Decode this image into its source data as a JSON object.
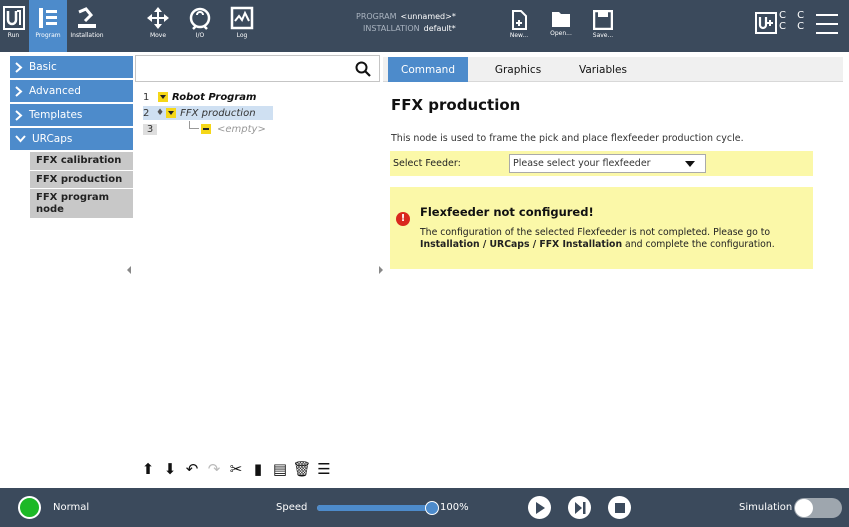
{
  "topbar": {
    "nav": [
      {
        "label": "Run",
        "icon": "ur-logo-icon"
      },
      {
        "label": "Program",
        "icon": "program-icon",
        "active": true
      },
      {
        "label": "Installation",
        "icon": "installation-icon"
      },
      {
        "label": "Move",
        "icon": "move-icon"
      },
      {
        "label": "I/O",
        "icon": "io-icon"
      },
      {
        "label": "Log",
        "icon": "log-icon"
      }
    ],
    "program_key": "PROGRAM",
    "program_value": "<unnamed>*",
    "installation_key": "INSTALLATION",
    "installation_value": "default*",
    "file_actions": [
      {
        "label": "New...",
        "icon": "new-file-icon"
      },
      {
        "label": "Open...",
        "icon": "open-folder-icon"
      },
      {
        "label": "Save...",
        "icon": "save-icon"
      }
    ],
    "cc_line1": "C C",
    "cc_line2": "C C"
  },
  "sidebar": {
    "groups": [
      {
        "label": "Basic",
        "expanded": false
      },
      {
        "label": "Advanced",
        "expanded": false
      },
      {
        "label": "Templates",
        "expanded": false
      },
      {
        "label": "URCaps",
        "expanded": true
      }
    ],
    "urcaps_items": [
      "FFX calibration",
      "FFX production",
      "FFX program node"
    ]
  },
  "tree": {
    "search_placeholder": "",
    "lines": [
      {
        "num": "1",
        "label": "Robot Program"
      },
      {
        "num": "2",
        "label": "FFX production"
      },
      {
        "num": "3",
        "label": "<empty>"
      }
    ]
  },
  "tabs": [
    "Command",
    "Graphics",
    "Variables"
  ],
  "node": {
    "title": "FFX production",
    "description": "This node is used to frame the pick and place flexfeeder production cycle.",
    "feeder_label": "Select Feeder:",
    "feeder_value": "Please select your flexfeeder",
    "warning_title": "Flexfeeder not configured!",
    "warning_line1": "The configuration of the selected Flexfeeder is not completed. Please go to",
    "warning_path": "Installation / URCaps / FFX Installation",
    "warning_tail": "and complete the configuration."
  },
  "bottombar": {
    "status": "Normal",
    "speed_label": "Speed",
    "speed_value": "100%",
    "speed_fraction": 1.0,
    "simulation_label": "Simulation",
    "simulation_on": false
  },
  "colors": {
    "topbar": "#3b4a5c",
    "accent": "#4d8bcb",
    "warning_bg": "#fbf8a8",
    "status_ok": "#1cb826",
    "marker_yellow": "#f5d718"
  }
}
